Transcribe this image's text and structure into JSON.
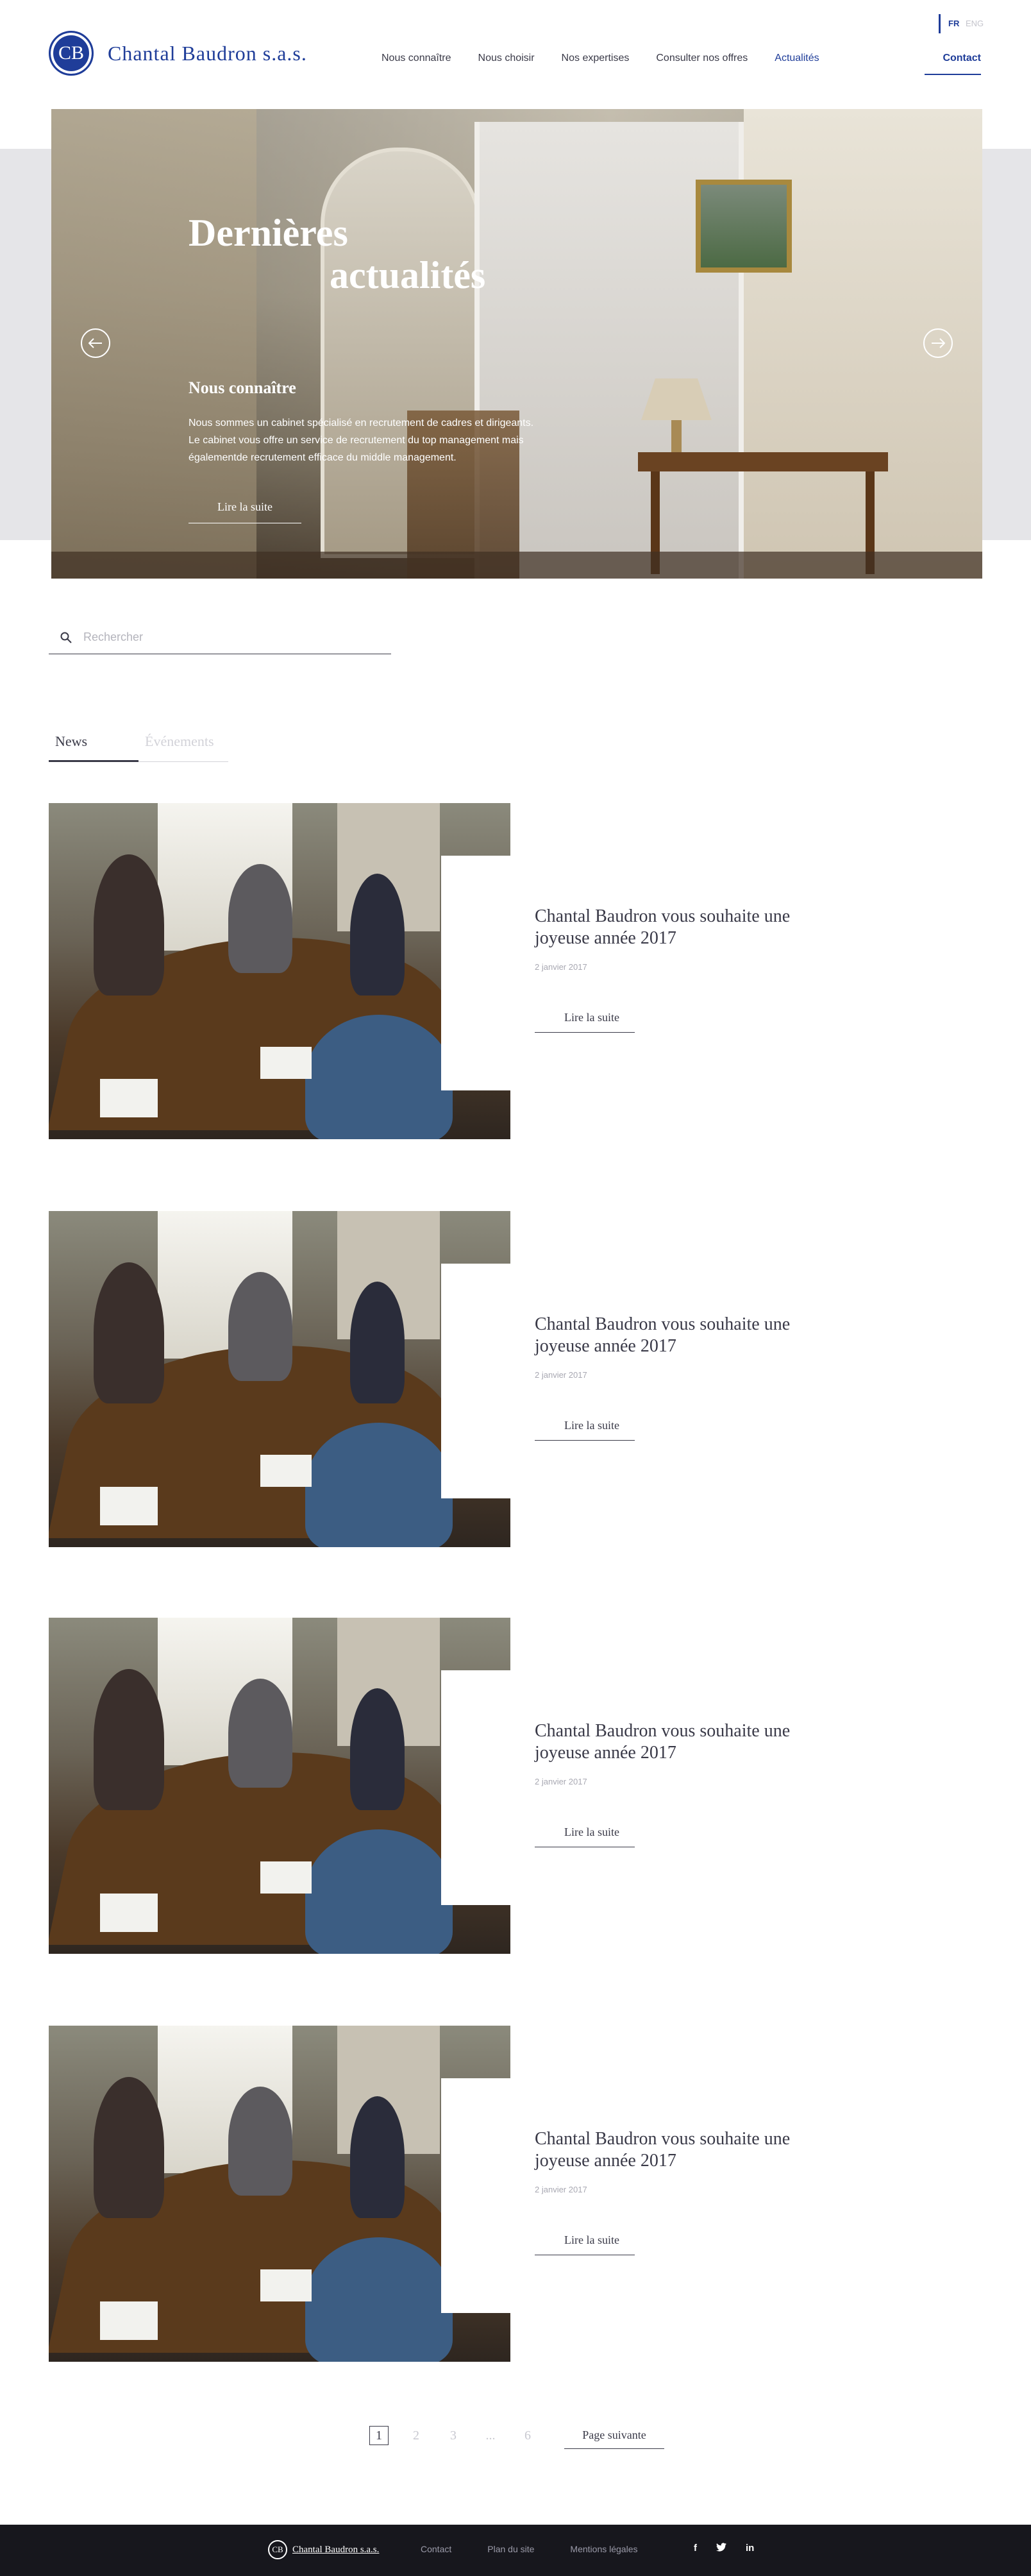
{
  "header": {
    "lang_current": "FR",
    "lang_other": "ENG",
    "logo_mark": "CB",
    "logo_text": "Chantal Baudron s.a.s.",
    "nav": [
      {
        "label": "Nous connaître"
      },
      {
        "label": "Nous choisir"
      },
      {
        "label": "Nos expertises"
      },
      {
        "label": "Consulter nos offres"
      },
      {
        "label": "Actualités",
        "active": true
      }
    ],
    "contact_label": "Contact"
  },
  "hero": {
    "title_line1": "Dernières",
    "title_line2": "actualités",
    "subtitle": "Nous connaître",
    "body_line1": "Nous sommes un cabinet spécialisé en recrutement de cadres et dirigeants.",
    "body_line2": "Le cabinet vous offre un service de recrutement du top management mais",
    "body_line3": "égalementde recrutement efficace du middle management.",
    "more_label": "Lire la suite",
    "prev_icon": "arrow-left-icon",
    "next_icon": "arrow-right-icon"
  },
  "search": {
    "placeholder": "Rechercher",
    "value": "",
    "icon": "search-icon"
  },
  "tabs": [
    {
      "label": "News",
      "active": true
    },
    {
      "label": "Événements",
      "active": false
    }
  ],
  "articles": [
    {
      "title_line1": "Chantal Baudron vous souhaite une",
      "title_line2": "joyeuse année 2017",
      "date": "2 janvier 2017",
      "more_label": "Lire la suite"
    },
    {
      "title_line1": "Chantal Baudron vous souhaite une",
      "title_line2": "joyeuse année 2017",
      "date": "2 janvier 2017",
      "more_label": "Lire la suite"
    },
    {
      "title_line1": "Chantal Baudron vous souhaite une",
      "title_line2": "joyeuse année 2017",
      "date": "2 janvier 2017",
      "more_label": "Lire la suite"
    },
    {
      "title_line1": "Chantal Baudron vous souhaite une",
      "title_line2": "joyeuse année 2017",
      "date": "2 janvier 2017",
      "more_label": "Lire la suite"
    }
  ],
  "pagination": {
    "pages": [
      "1",
      "2",
      "3",
      "...",
      "6"
    ],
    "current": "1",
    "next_label": "Page suivante"
  },
  "footer": {
    "logo_mark": "CB",
    "logo_text": "Chantal Baudron s.a.s.",
    "links": [
      "Contact",
      "Plan du site",
      "Mentions légales"
    ],
    "social": [
      {
        "icon": "facebook-icon",
        "glyph": "f"
      },
      {
        "icon": "twitter-icon",
        "glyph": "t"
      },
      {
        "icon": "linkedin-icon",
        "glyph": "in"
      }
    ]
  },
  "colors": {
    "brand_blue": "#1f3d99",
    "text": "#3a3a48",
    "footer_bg": "#17171d",
    "hero_band": "#e5e5e8"
  }
}
